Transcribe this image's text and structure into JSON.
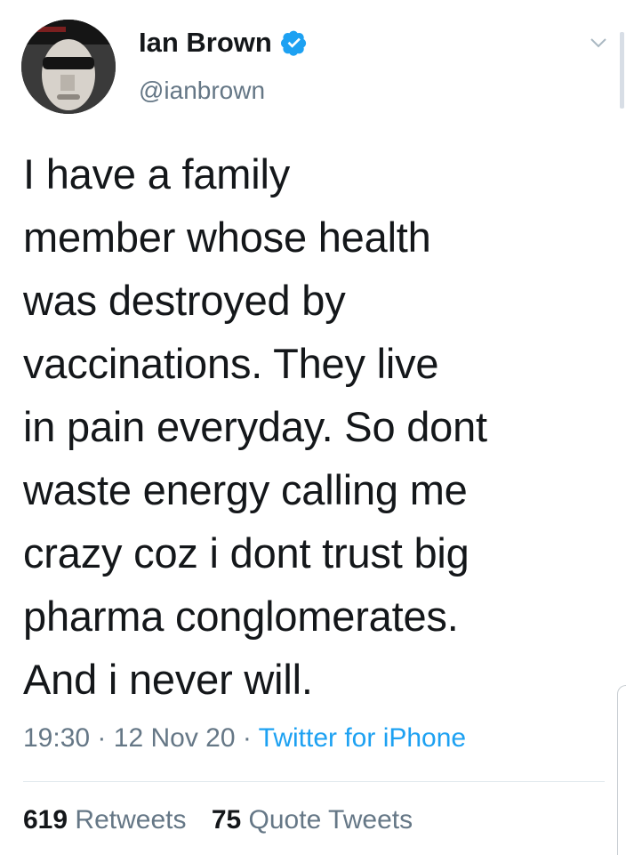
{
  "user": {
    "display_name": "Ian Brown",
    "handle": "@ianbrown",
    "verified_color": "#1da1f2"
  },
  "tweet": {
    "lines": [
      "I have a family",
      "member whose health",
      "was destroyed by",
      "vaccinations. They live",
      "in pain everyday. So dont",
      "waste energy calling me",
      "crazy coz i dont trust big",
      "pharma conglomerates.",
      "And i never will."
    ],
    "time": "19:30",
    "date": "12 Nov 20",
    "separator": "·",
    "source": "Twitter for iPhone"
  },
  "stats": {
    "retweets_count": "619",
    "retweets_label": "Retweets",
    "quotes_count": "75",
    "quotes_label": "Quote Tweets"
  },
  "icons": {
    "verified": "verified-badge-icon",
    "caret": "chevron-down-icon"
  }
}
